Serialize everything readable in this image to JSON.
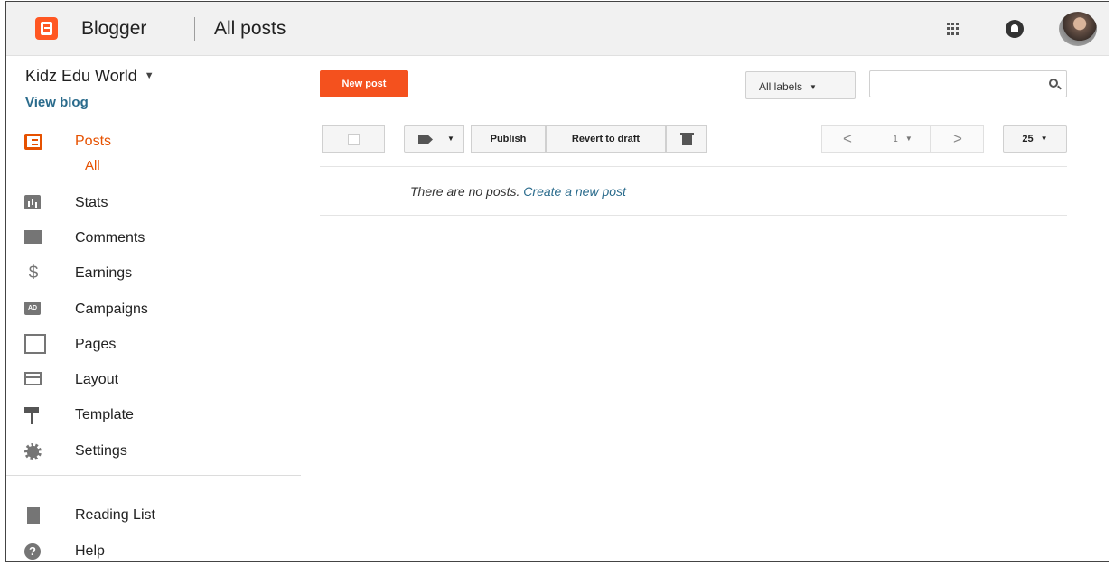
{
  "header": {
    "brand": "Blogger",
    "title": "All posts"
  },
  "sidebar": {
    "blog_name": "Kidz Edu World",
    "view_blog": "View blog",
    "sub_all": "All",
    "items": [
      {
        "label": "Posts",
        "icon": "posts-icon",
        "active": true
      },
      {
        "label": "Stats",
        "icon": "stats-icon"
      },
      {
        "label": "Comments",
        "icon": "comments-icon"
      },
      {
        "label": "Earnings",
        "icon": "earnings-icon"
      },
      {
        "label": "Campaigns",
        "icon": "campaigns-icon"
      },
      {
        "label": "Pages",
        "icon": "pages-icon"
      },
      {
        "label": "Layout",
        "icon": "layout-icon"
      },
      {
        "label": "Template",
        "icon": "template-icon"
      },
      {
        "label": "Settings",
        "icon": "settings-icon"
      }
    ],
    "footer_items": [
      {
        "label": "Reading List",
        "icon": "reading-list-icon"
      },
      {
        "label": "Help",
        "icon": "help-icon"
      }
    ],
    "earnings_glyph": "$",
    "campaigns_glyph": "AD",
    "help_glyph": "?"
  },
  "toolbar": {
    "new_post": "New post",
    "labels_filter": "All labels",
    "publish": "Publish",
    "revert": "Revert to draft",
    "page": "1",
    "prev_glyph": "<",
    "next_glyph": ">",
    "per_page": "25"
  },
  "main": {
    "empty_text": "There are no posts.",
    "create_link": "Create a new post"
  },
  "colors": {
    "accent": "#f4511e",
    "active_text": "#e65100",
    "link": "#2a6b8c"
  }
}
